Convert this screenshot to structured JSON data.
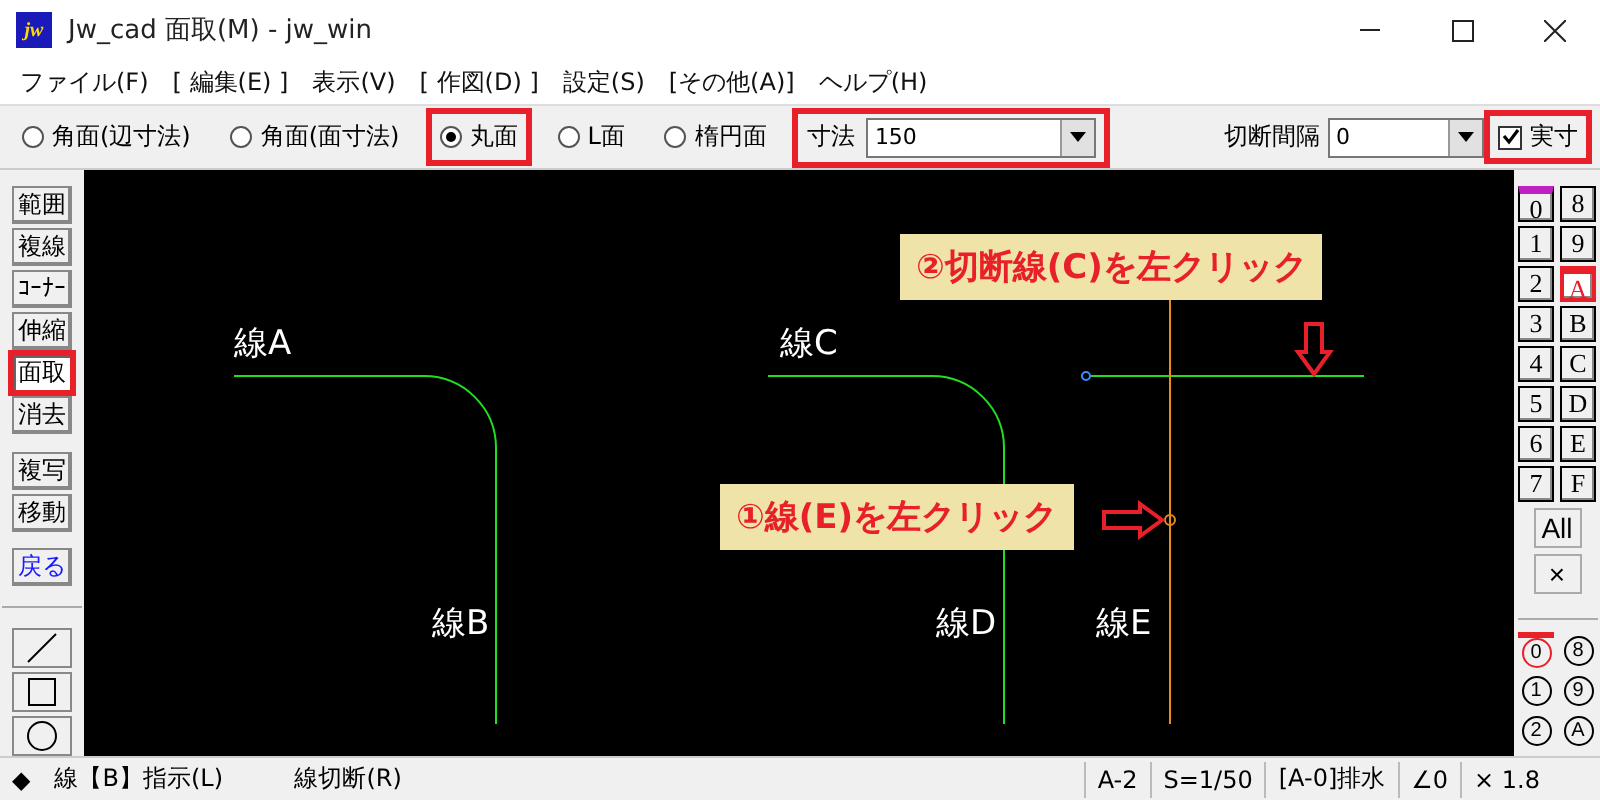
{
  "window": {
    "logo": "jw",
    "title": "Jw_cad 面取(M) - jw_win"
  },
  "menu": [
    "ファイル(F)",
    "[ 編集(E) ]",
    "表示(V)",
    "[ 作図(D) ]",
    "設定(S)",
    "[その他(A)]",
    "ヘルプ(H)"
  ],
  "toolbar": {
    "radios": [
      {
        "label": "角面(辺寸法)",
        "selected": false,
        "highlighted": false
      },
      {
        "label": "角面(面寸法)",
        "selected": false,
        "highlighted": false
      },
      {
        "label": "丸面",
        "selected": true,
        "highlighted": true
      },
      {
        "label": "L面",
        "selected": false,
        "highlighted": false
      },
      {
        "label": "楕円面",
        "selected": false,
        "highlighted": false
      }
    ],
    "dimension": {
      "label": "寸法",
      "value": "150",
      "highlighted": true
    },
    "cut_interval": {
      "label": "切断間隔",
      "value": "0"
    },
    "actual_size": {
      "label": "実寸",
      "checked": true,
      "highlighted": true
    }
  },
  "left_tools": [
    {
      "kind": "command",
      "label": "範囲",
      "selected": false,
      "highlighted": false
    },
    {
      "kind": "command",
      "label": "複線",
      "selected": false,
      "highlighted": false
    },
    {
      "kind": "command",
      "label": "ｺｰﾅｰ",
      "selected": false,
      "highlighted": false
    },
    {
      "kind": "command",
      "label": "伸縮",
      "selected": false,
      "highlighted": false
    },
    {
      "kind": "command",
      "label": "面取",
      "selected": true,
      "highlighted": true
    },
    {
      "kind": "command",
      "label": "消去",
      "selected": false,
      "highlighted": false
    },
    {
      "kind": "gap"
    },
    {
      "kind": "command",
      "label": "複写",
      "selected": false,
      "highlighted": false
    },
    {
      "kind": "command",
      "label": "移動",
      "selected": false,
      "highlighted": false
    },
    {
      "kind": "gap"
    },
    {
      "kind": "undo",
      "label": "戻る",
      "selected": false,
      "highlighted": false
    },
    {
      "kind": "divider"
    },
    {
      "kind": "line"
    },
    {
      "kind": "rect"
    },
    {
      "kind": "circle"
    }
  ],
  "canvas": {
    "labels": [
      "線A",
      "線C",
      "線B",
      "線D",
      "線E"
    ],
    "steps": [
      {
        "text": "②切断線(C)を左クリック"
      },
      {
        "text": "①線(E)を左クリック"
      }
    ]
  },
  "layers": [
    {
      "label": "0",
      "selected": false,
      "current": true
    },
    {
      "label": "8",
      "selected": false,
      "current": false
    },
    {
      "label": "1",
      "selected": false,
      "current": false
    },
    {
      "label": "9",
      "selected": false,
      "current": false
    },
    {
      "label": "2",
      "selected": false,
      "current": false
    },
    {
      "label": "A",
      "selected": true,
      "current": true
    },
    {
      "label": "3",
      "selected": false,
      "current": false
    },
    {
      "label": "B",
      "selected": false,
      "current": false
    },
    {
      "label": "4",
      "selected": false,
      "current": false
    },
    {
      "label": "C",
      "selected": false,
      "current": false
    },
    {
      "label": "5",
      "selected": false,
      "current": false
    },
    {
      "label": "D",
      "selected": false,
      "current": false
    },
    {
      "label": "6",
      "selected": false,
      "current": false
    },
    {
      "label": "E",
      "selected": false,
      "current": false
    },
    {
      "label": "7",
      "selected": false,
      "current": false
    },
    {
      "label": "F",
      "selected": false,
      "current": false
    }
  ],
  "layer_buttons": [
    "All",
    "×"
  ],
  "groups": [
    {
      "label": "0",
      "selected": true
    },
    {
      "label": "8",
      "selected": false
    },
    {
      "label": "1",
      "selected": false
    },
    {
      "label": "9",
      "selected": false
    },
    {
      "label": "2",
      "selected": false
    },
    {
      "label": "A",
      "selected": false
    }
  ],
  "status_bar": {
    "left": [
      "◆",
      "線【B】指示(L)",
      "線切断(R)"
    ],
    "right": [
      "A-2",
      "S=1/50",
      "[A-0]排水",
      "∠0",
      "× 1.8"
    ]
  }
}
